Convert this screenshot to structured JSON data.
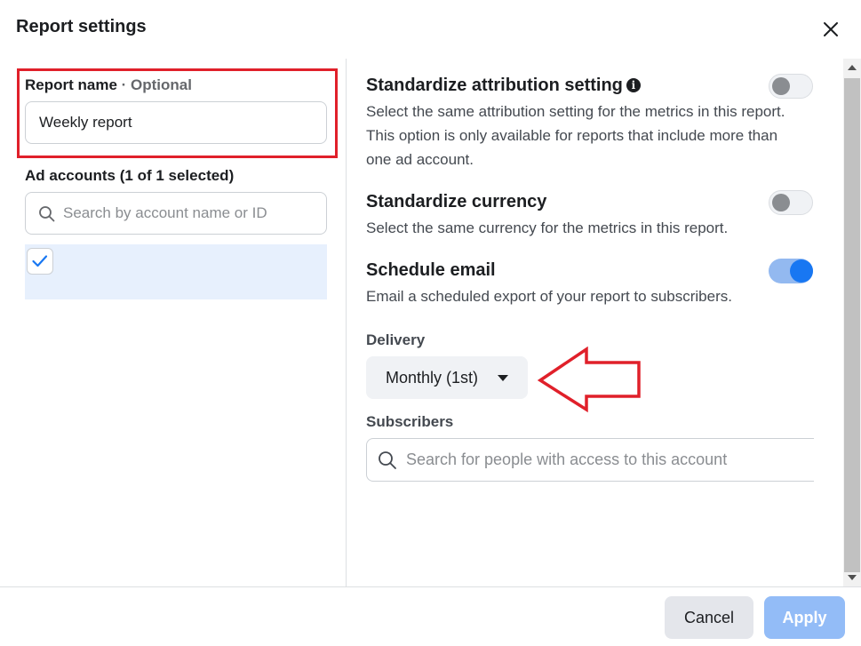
{
  "dialog": {
    "title": "Report settings",
    "close_icon": "close-icon"
  },
  "left": {
    "report_name_label": "Report name",
    "report_name_optional": " · Optional",
    "report_name_value": "Weekly report",
    "ad_accounts_label": "Ad accounts (1 of 1 selected)",
    "account_search_placeholder": "Search by account name or ID",
    "account_checked": true
  },
  "right": {
    "settings": [
      {
        "title": "Standardize attribution setting",
        "description": "Select the same attribution setting for the metrics in this report. This option is only available for reports that include more than one ad account.",
        "enabled": false,
        "has_info_icon": true
      },
      {
        "title": "Standardize currency",
        "description": "Select the same currency for the metrics in this report.",
        "enabled": false
      },
      {
        "title": "Schedule email",
        "description": "Email a scheduled export of your report to subscribers.",
        "enabled": true
      }
    ],
    "delivery_label": "Delivery",
    "delivery_value": "Monthly (1st)",
    "subscribers_label": "Subscribers",
    "subscribers_placeholder": "Search for people with access to this account"
  },
  "footer": {
    "cancel_label": "Cancel",
    "apply_label": "Apply"
  },
  "colors": {
    "accent": "#1877f2",
    "annotation_red": "#e0202a",
    "selected_row": "#e7f0fd"
  }
}
